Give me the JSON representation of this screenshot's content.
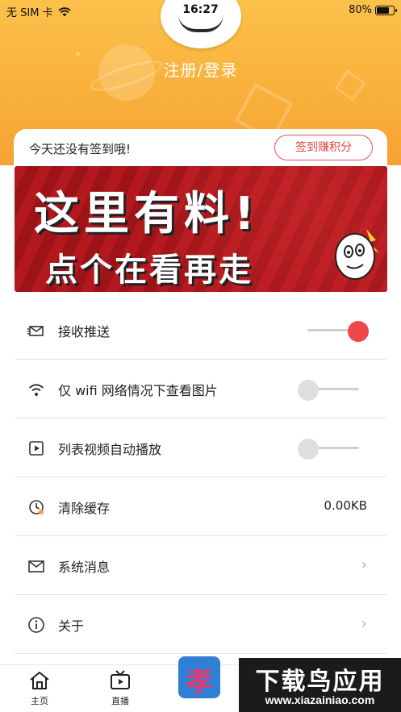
{
  "status_bar": {
    "carrier": "无 SIM 卡",
    "time": "16:27",
    "battery": "80%",
    "battery_level": 0.8
  },
  "header": {
    "login_text": "注册/登录"
  },
  "sign_in": {
    "prompt": "今天还没有签到哦!",
    "button_label": "签到赚积分"
  },
  "banner": {
    "line1": "这里有料!",
    "line2": "点个在看再走"
  },
  "settings": {
    "items": [
      {
        "label": "接收推送",
        "icon": "envelope-open-icon",
        "control": "toggle",
        "on": true
      },
      {
        "label": "仅 wifi 网络情况下查看图片",
        "icon": "wifi-icon",
        "control": "toggle",
        "on": false
      },
      {
        "label": "列表视频自动播放",
        "icon": "video-icon",
        "control": "toggle",
        "on": false
      },
      {
        "label": "清除缓存",
        "icon": "clock-icon",
        "control": "value",
        "value": "0.00KB"
      },
      {
        "label": "系统消息",
        "icon": "mail-icon",
        "control": "chevron"
      },
      {
        "label": "关于",
        "icon": "info-icon",
        "control": "chevron"
      }
    ]
  },
  "tab_bar": {
    "tabs": [
      {
        "label": "主页",
        "icon": "home-icon"
      },
      {
        "label": "直播",
        "icon": "tv-icon"
      }
    ],
    "center_logo_text": "孝"
  },
  "watermark": {
    "line1": "下载鸟应用",
    "line2": "www.xiazainiao.com"
  },
  "colors": {
    "accent": "#f04848",
    "header_top": "#fbc14b",
    "header_bottom": "#f6a235",
    "banner_red": "#b3181e"
  }
}
